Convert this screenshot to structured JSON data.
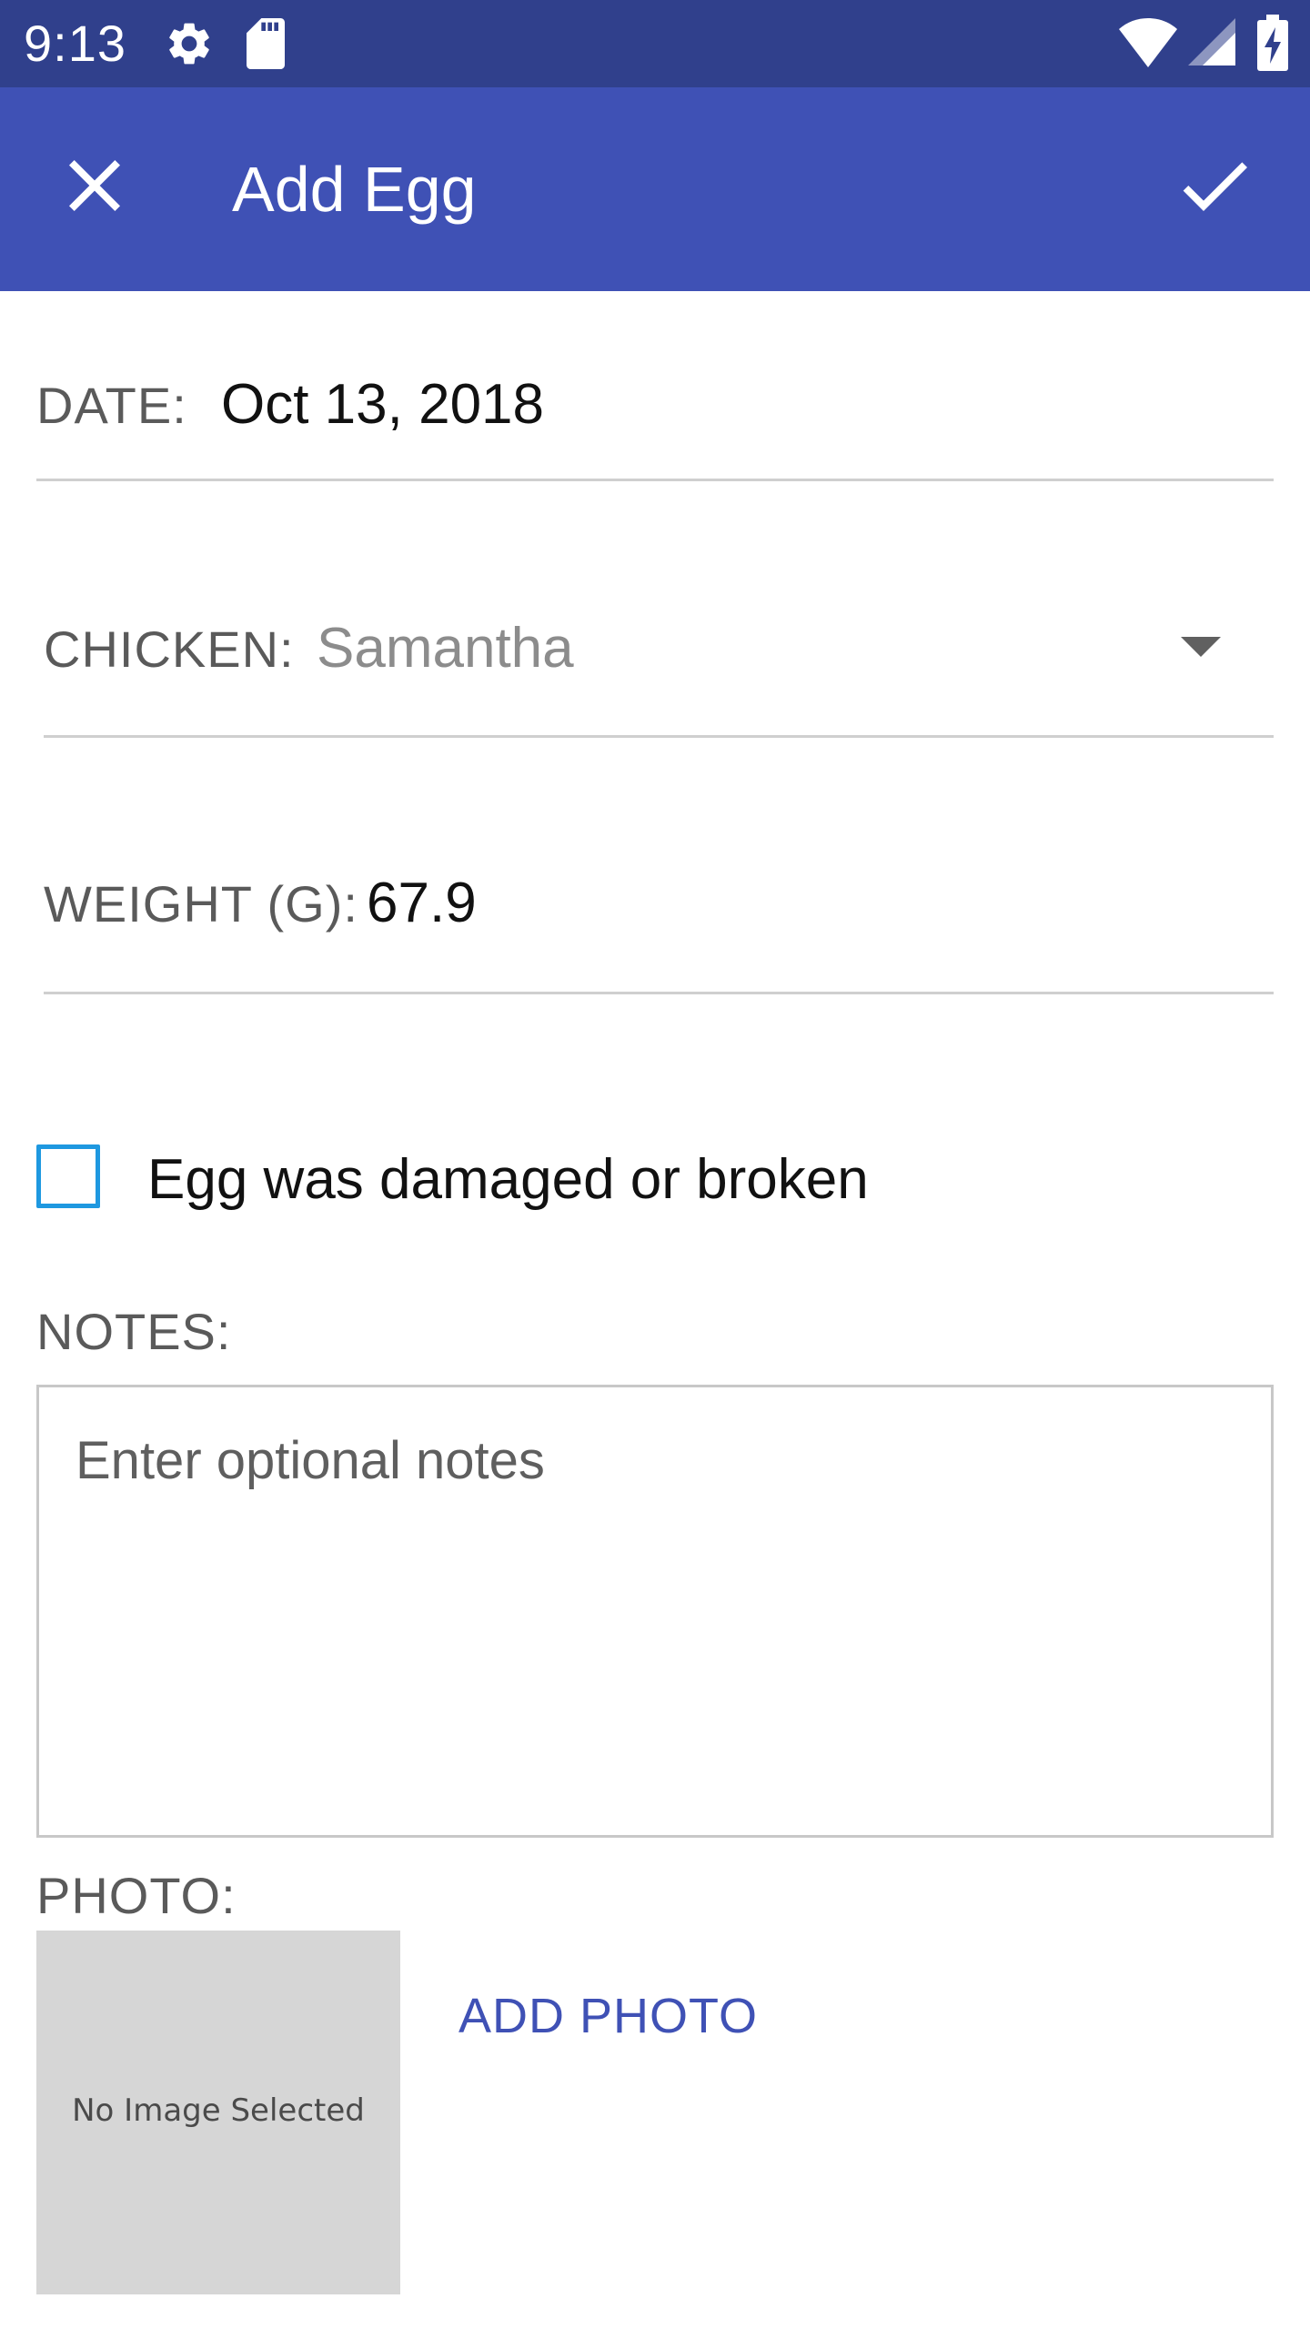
{
  "status_bar": {
    "time": "9:13",
    "icons": [
      "settings-icon",
      "sd-card-icon",
      "wifi-icon",
      "cell-signal-icon",
      "battery-charging-icon"
    ]
  },
  "app_bar": {
    "title": "Add Egg",
    "close_icon": "close-icon",
    "confirm_icon": "check-icon",
    "color": "#3f51b5"
  },
  "form": {
    "date": {
      "label": "DATE:",
      "value": "Oct 13, 2018"
    },
    "chicken": {
      "label": "CHICKEN:",
      "selected": "Samantha"
    },
    "weight": {
      "label": "WEIGHT (G):",
      "value": "67.9"
    },
    "damaged": {
      "label": "Egg was damaged or broken",
      "checked": false
    },
    "notes": {
      "label": "NOTES:",
      "placeholder": "Enter optional notes",
      "value": ""
    },
    "photo": {
      "label": "PHOTO:",
      "empty_text": "No Image Selected",
      "add_button": "ADD PHOTO"
    }
  }
}
